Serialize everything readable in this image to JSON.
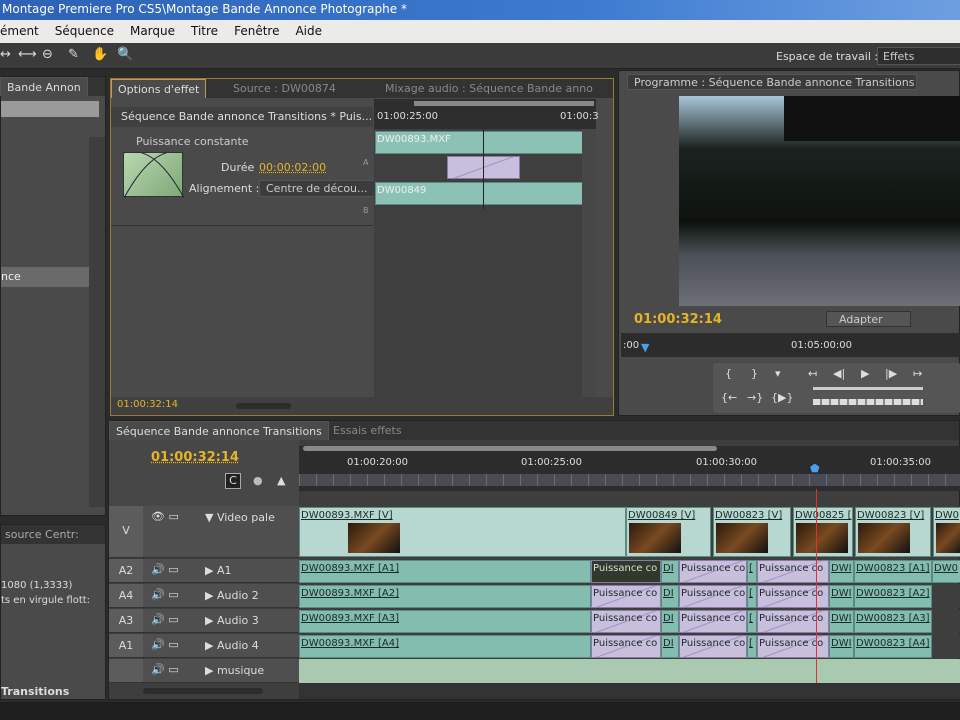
{
  "window": {
    "title": "Montage Premiere Pro CS5\\Montage Bande Annonce Photographe *"
  },
  "menu": [
    "ément",
    "Séquence",
    "Marque",
    "Titre",
    "Fenêtre",
    "Aide"
  ],
  "workspace": {
    "label": "Espace de travail :",
    "value": "Effets"
  },
  "project_panel": {
    "tab": "Bande Annon",
    "selected_item": "nce"
  },
  "info_panel": {
    "tab": "source Centr:",
    "line1": "1080 (1,3333)",
    "line2": "ts en virgule flott:",
    "footer": "Transitions"
  },
  "effect_options": {
    "tabs": [
      "Options d'effet",
      "Source : DW00874",
      "Mixage audio : Séquence Bande anno"
    ],
    "header": "Séquence Bande annonce Transitions * Puis...",
    "effect_name": "Puissance constante",
    "duration_label": "Durée",
    "duration_value": "00:00:02:00",
    "alignment_label": "Alignement :",
    "alignment_value": "Centre de décou...",
    "marker_a": "A",
    "marker_b": "B",
    "ruler": [
      "01:00:25:00",
      "01:00:3"
    ],
    "clip_a": "DW00893.MXF",
    "clip_b": "DW00849",
    "timecode": "01:00:32:14"
  },
  "program": {
    "tab": "Programme : Séquence Bande annonce Transitions",
    "timecode": "01:00:32:14",
    "fit": "Adapter",
    "ruler_start": ":00",
    "ruler_mid": "01:05:00:00"
  },
  "timeline": {
    "tabs": [
      "Séquence Bande annonce Transitions",
      "Essais effets"
    ],
    "timecode": "01:00:32:14",
    "ruler": [
      "01:00:20:00",
      "01:00:25:00",
      "01:00:30:00",
      "01:00:35:00"
    ],
    "tracks": [
      {
        "label": "V",
        "name": "Video pale"
      },
      {
        "label": "A2",
        "name": "A1"
      },
      {
        "label": "A4",
        "name": "Audio 2"
      },
      {
        "label": "A3",
        "name": "Audio 3"
      },
      {
        "label": "A1",
        "name": "Audio 4"
      },
      {
        "label": "",
        "name": "musique"
      }
    ],
    "video_clips": [
      "DW00893.MXF [V]",
      "DW00849 [V]",
      "DW00823 [V]",
      "DW00825 [",
      "DW00823 [V]",
      "DW0"
    ],
    "audio_clips": [
      [
        "DW00893.MXF [A1]",
        "Puissance co",
        "DI",
        "Puissance co",
        "[",
        "Puissance co",
        "DWI",
        "DW00823 [A1]",
        "DW0"
      ],
      [
        "DW00893.MXF [A2]",
        "Puissance co",
        "DI",
        "Puissance co",
        "[",
        "Puissance co",
        "DWI",
        "DW00823 [A2]"
      ],
      [
        "DW00893.MXF [A3]",
        "Puissance co",
        "DI",
        "Puissance co",
        "[",
        "Puissance co",
        "DWI",
        "DW00823 [A3]"
      ],
      [
        "DW00893.MXF [A4]",
        "Puissance co",
        "DI",
        "Puissance co",
        "[",
        "Puissance co",
        "DWI",
        "DW00823 [A4]"
      ]
    ]
  }
}
